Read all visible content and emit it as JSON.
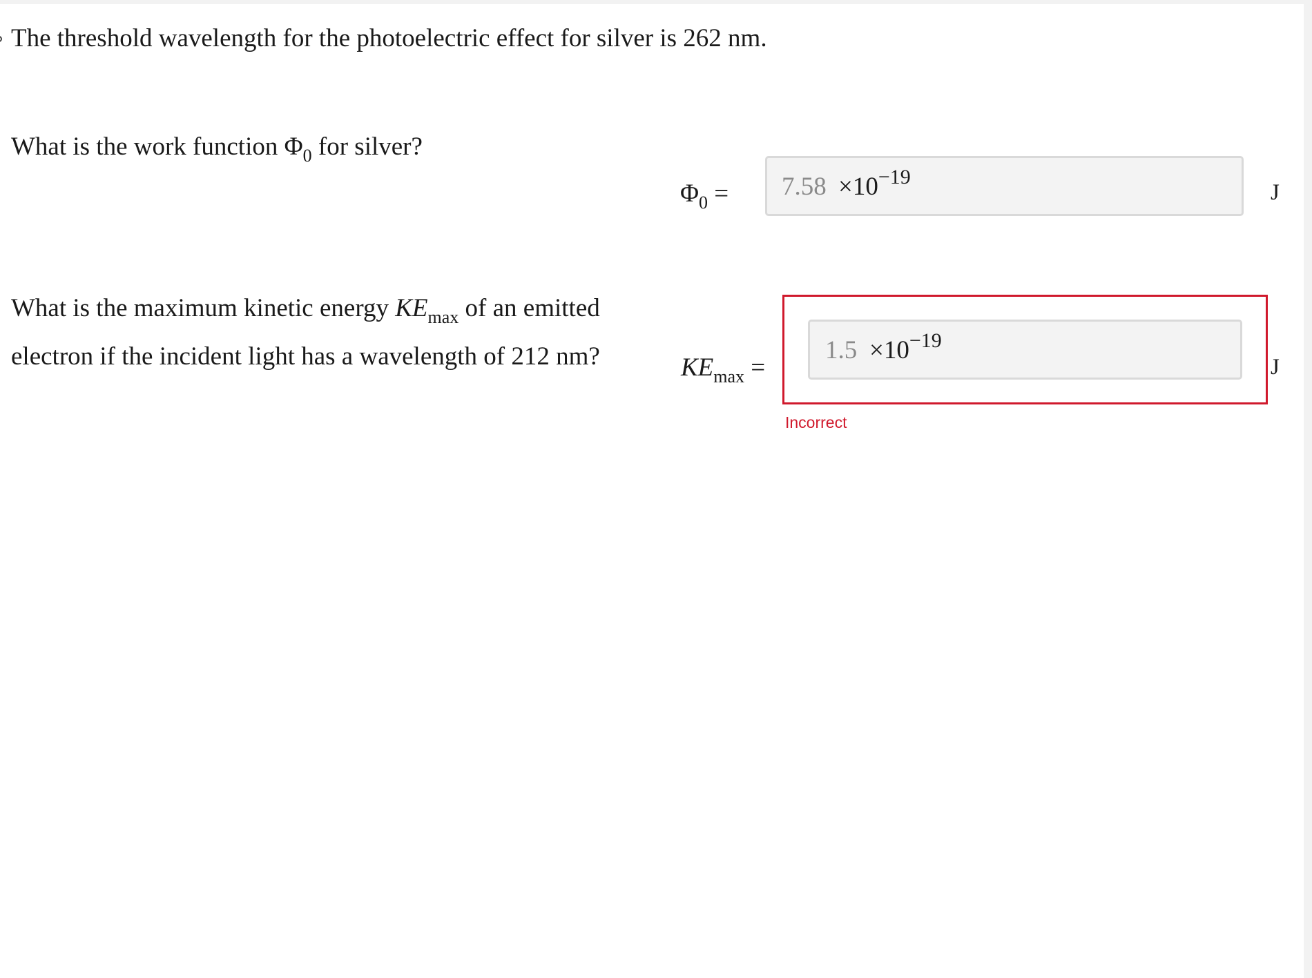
{
  "problem": {
    "intro": "The threshold wavelength for the photoelectric effect for silver is 262 nm."
  },
  "question1": {
    "before": "What is the work function ",
    "symbol": "Φ",
    "subscript": "0",
    "after": " for silver?",
    "lhs_symbol": "Φ",
    "lhs_subscript": "0",
    "equals": "=",
    "answer_value": "7.58",
    "multiplier": "×10",
    "exponent": "−19",
    "unit": "J"
  },
  "question2": {
    "before": "What is the maximum kinetic energy ",
    "symbol": "KE",
    "subscript": "max",
    "after": " of an emitted electron if the incident light has a wavelength of 212 nm?",
    "lhs_symbol": "KE",
    "lhs_subscript": "max",
    "equals": "=",
    "answer_value": "1.5",
    "multiplier": "×10",
    "exponent": "−19",
    "unit": "J",
    "feedback": "Incorrect",
    "feedback_color": "#d0192c"
  }
}
